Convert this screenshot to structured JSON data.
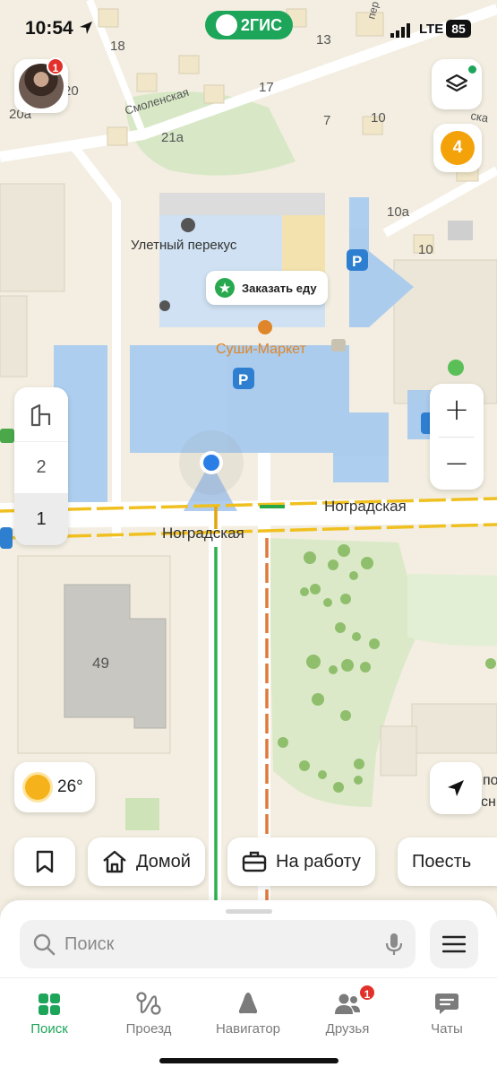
{
  "status_bar": {
    "time": "10:54",
    "network": "LTE",
    "battery": "85"
  },
  "app": {
    "logo": "2ГИС"
  },
  "map": {
    "streets": [
      "Смоленская",
      "Ноградская",
      "Ноградская"
    ],
    "house_numbers": [
      "18",
      "20",
      "20а",
      "13",
      "17",
      "7",
      "10",
      "21а",
      "10а",
      "10",
      "49"
    ],
    "pois": {
      "snack": "Улетный перекус",
      "order_food": "Заказать еду",
      "sushi": "Суши-Маркет"
    },
    "edge_labels": [
      "по",
      "сн"
    ],
    "street_top_right": "пер",
    "street_right": "ска"
  },
  "controls": {
    "avatar_badge": "1",
    "orange_badge": "4",
    "floors": [
      "2",
      "1"
    ],
    "zoom_in": "+",
    "zoom_out": "−"
  },
  "weather": {
    "temp": "26°"
  },
  "quick_chips": {
    "home": "Домой",
    "work": "На работу",
    "eat": "Поесть"
  },
  "search": {
    "placeholder": "Поиск"
  },
  "tabs": [
    {
      "label": "Поиск",
      "icon": "grid-icon",
      "active": true
    },
    {
      "label": "Проезд",
      "icon": "route-icon",
      "active": false
    },
    {
      "label": "Навигатор",
      "icon": "navigator-icon",
      "active": false
    },
    {
      "label": "Друзья",
      "icon": "friends-icon",
      "active": false,
      "badge": "1"
    },
    {
      "label": "Чаты",
      "icon": "chat-icon",
      "active": false
    }
  ],
  "colors": {
    "accent": "#1da55a",
    "badge_red": "#e2312a",
    "orange": "#f3a20a",
    "parking_blue": "#2f7fd1"
  }
}
